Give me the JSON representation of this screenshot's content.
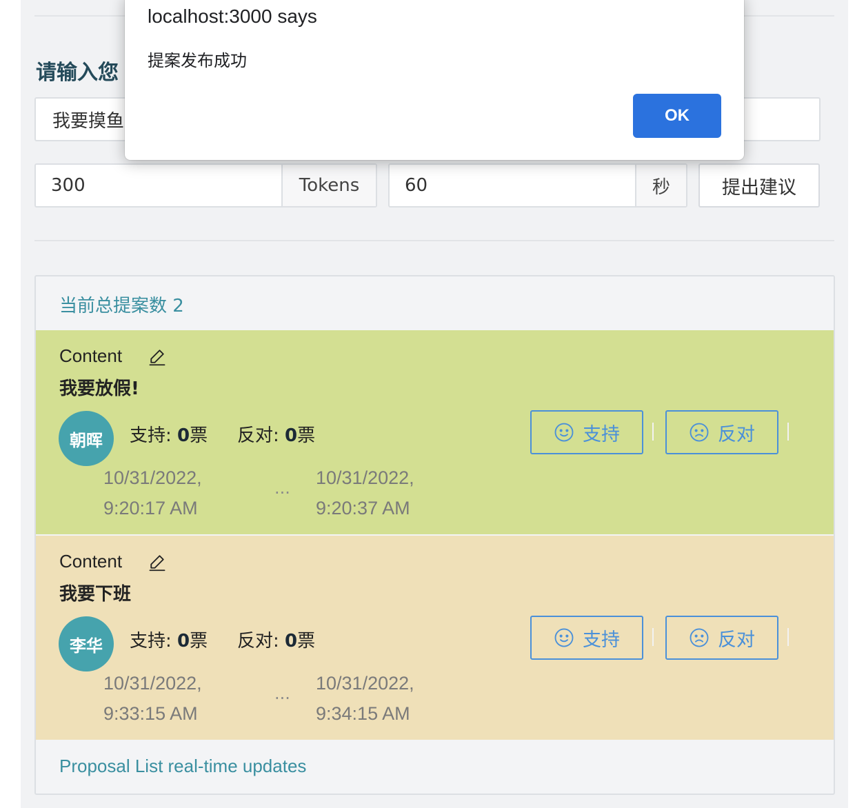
{
  "form": {
    "title": "请输入您",
    "content_value": "我要摸鱼",
    "tokens_value": "300",
    "tokens_unit": "Tokens",
    "seconds_value": "60",
    "seconds_unit": "秒",
    "submit_label": "提出建议"
  },
  "proposal_list": {
    "header": "当前总提案数 2",
    "footer": "Proposal List real-time updates",
    "items": [
      {
        "content_label": "Content",
        "content": "我要放假!",
        "author": "朝晖",
        "support_label": "支持:",
        "support_count": "0",
        "oppose_label": "反对:",
        "oppose_count": "0",
        "vote_unit": "票",
        "support_button": "支持",
        "oppose_button": "反对",
        "start_date": "10/31/2022,",
        "start_time": "9:20:17 AM",
        "separator": "...",
        "end_date": "10/31/2022,",
        "end_time": "9:20:37 AM",
        "bg_color": "#d3df92"
      },
      {
        "content_label": "Content",
        "content": "我要下班",
        "author": "李华",
        "support_label": "支持:",
        "support_count": "0",
        "oppose_label": "反对:",
        "oppose_count": "0",
        "vote_unit": "票",
        "support_button": "支持",
        "oppose_button": "反对",
        "start_date": "10/31/2022,",
        "start_time": "9:33:15 AM",
        "separator": "...",
        "end_date": "10/31/2022,",
        "end_time": "9:34:15 AM",
        "bg_color": "#efe0b8"
      }
    ]
  },
  "alert_dialog": {
    "title": "localhost:3000 says",
    "message": "提案发布成功",
    "ok_label": "OK"
  },
  "colors": {
    "accent_blue": "#4a90d9",
    "teal": "#46a3ad",
    "ok_button": "#2b72de"
  },
  "icons": {
    "edit": "pencil-icon",
    "support": "smile-icon",
    "oppose": "frown-icon"
  }
}
